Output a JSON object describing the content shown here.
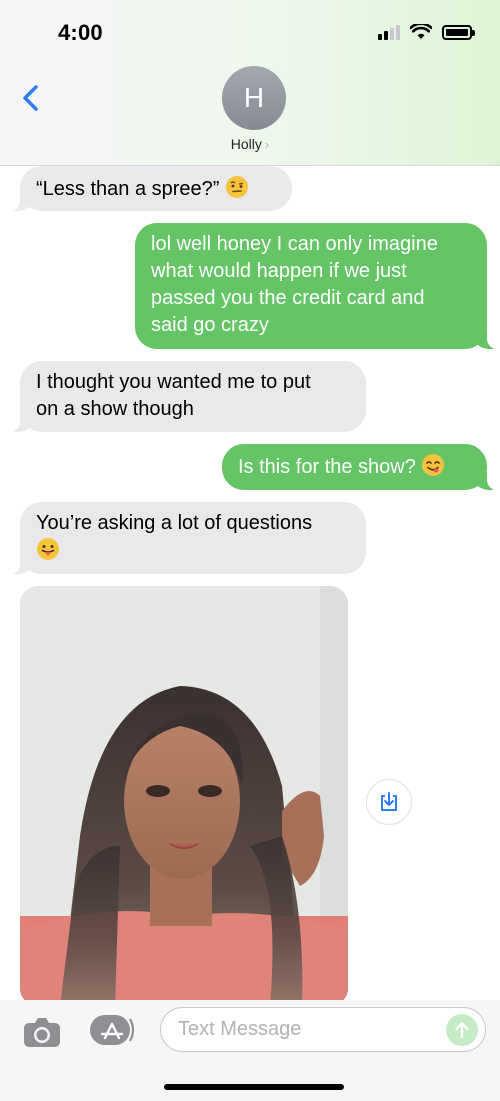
{
  "status_bar": {
    "time": "4:00"
  },
  "header": {
    "avatar_initial": "H",
    "contact_name": "Holly",
    "chevron": "›"
  },
  "messages": [
    {
      "direction": "in",
      "text": "“Less than a spree?”",
      "emoji": "face-with-raised-eyebrow"
    },
    {
      "direction": "out",
      "lines": [
        "lol well honey I can only imagine",
        "what would happen if we just",
        "passed you the credit card and",
        "said go crazy"
      ]
    },
    {
      "direction": "in",
      "lines": [
        "I thought you wanted me to put",
        "on a show though"
      ]
    },
    {
      "direction": "out",
      "text": "Is this for the show?",
      "emoji": "face-savoring-food"
    },
    {
      "direction": "in",
      "text": "You’re asking a lot of questions",
      "emoji": "face-with-tongue"
    },
    {
      "direction": "in",
      "type": "photo",
      "description_icon": "photo-attachment"
    }
  ],
  "compose": {
    "placeholder": "Text Message"
  },
  "colors": {
    "outgoing_bubble": "#65c466",
    "incoming_bubble": "#e9e9eb",
    "accent": "#2f7cf6"
  },
  "icons": [
    "back-chevron-icon",
    "camera-icon",
    "app-store-icon",
    "send-arrow-icon",
    "save-download-icon"
  ]
}
